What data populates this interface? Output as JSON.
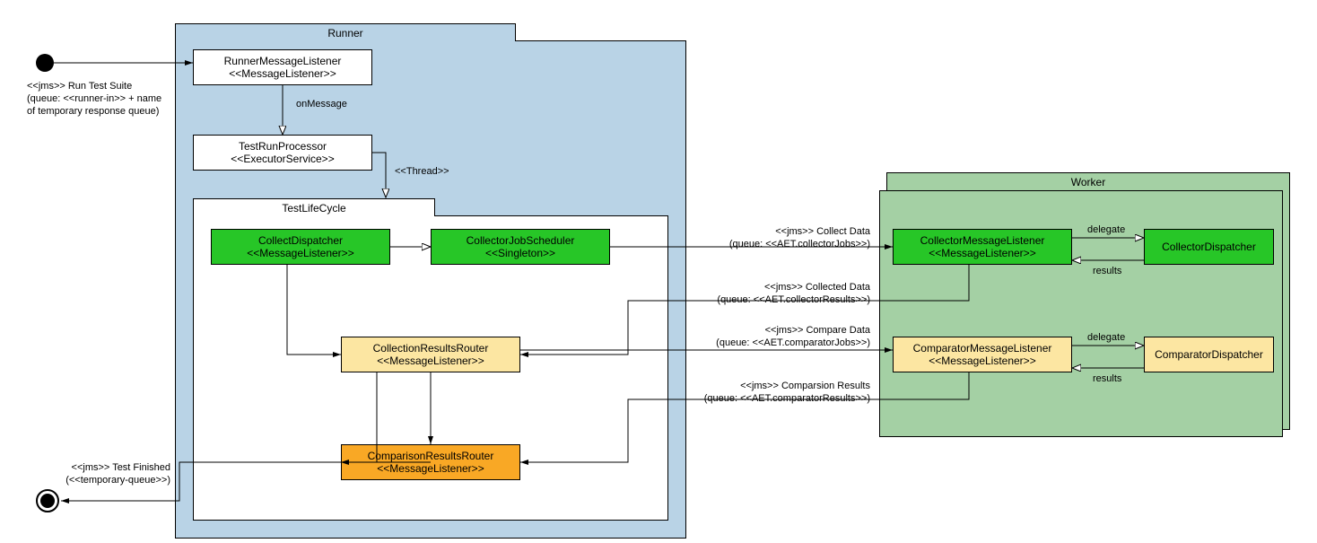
{
  "start_dot": "start",
  "end_dot": "end",
  "runner": {
    "title": "Runner",
    "runner_listener": {
      "name": "RunnerMessageListener",
      "stereotype": "<<MessageListener>>"
    },
    "test_run_processor": {
      "name": "TestRunProcessor",
      "stereotype": "<<ExecutorService>>"
    },
    "lifecycle": {
      "title": "TestLifeCycle",
      "collect_dispatcher": {
        "name": "CollectDispatcher",
        "stereotype": "<<MessageListener>>"
      },
      "collector_job_scheduler": {
        "name": "CollectorJobScheduler",
        "stereotype": "<<Singleton>>"
      },
      "collection_results_router": {
        "name": "CollectionResultsRouter",
        "stereotype": "<<MessageListener>>"
      },
      "comparison_results_router": {
        "name": "ComparisonResultsRouter",
        "stereotype": "<<MessageListener>>"
      }
    }
  },
  "worker": {
    "title": "Worker",
    "collector_listener": {
      "name": "CollectorMessageListener",
      "stereotype": "<<MessageListener>>"
    },
    "collector_dispatcher": {
      "name": "CollectorDispatcher"
    },
    "comparator_listener": {
      "name": "ComparatorMessageListener",
      "stereotype": "<<MessageListener>>"
    },
    "comparator_dispatcher": {
      "name": "ComparatorDispatcher"
    }
  },
  "edges": {
    "run_test_suite": "<<jms>> Run Test Suite\n(queue: <<runner-in>> + name\nof temporary response queue)",
    "on_message": "onMessage",
    "thread": "<<Thread>>",
    "collect_data": "<<jms>> Collect Data\n(queue: <<AET.collectorJobs>>)",
    "collected_data": "<<jms>> Collected Data\n(queue: <<AET.collectorResults>>)",
    "compare_data": "<<jms>> Compare Data\n(queue: <<AET.comparatorJobs>>)",
    "comparison_results": "<<jms>> Comparsion Results\n(queue: <<AET.comparatorResults>>)",
    "delegate1": "delegate",
    "results1": "results",
    "delegate2": "delegate",
    "results2": "results",
    "test_finished": "<<jms>> Test Finished\n(<<temporary-queue>>)"
  }
}
